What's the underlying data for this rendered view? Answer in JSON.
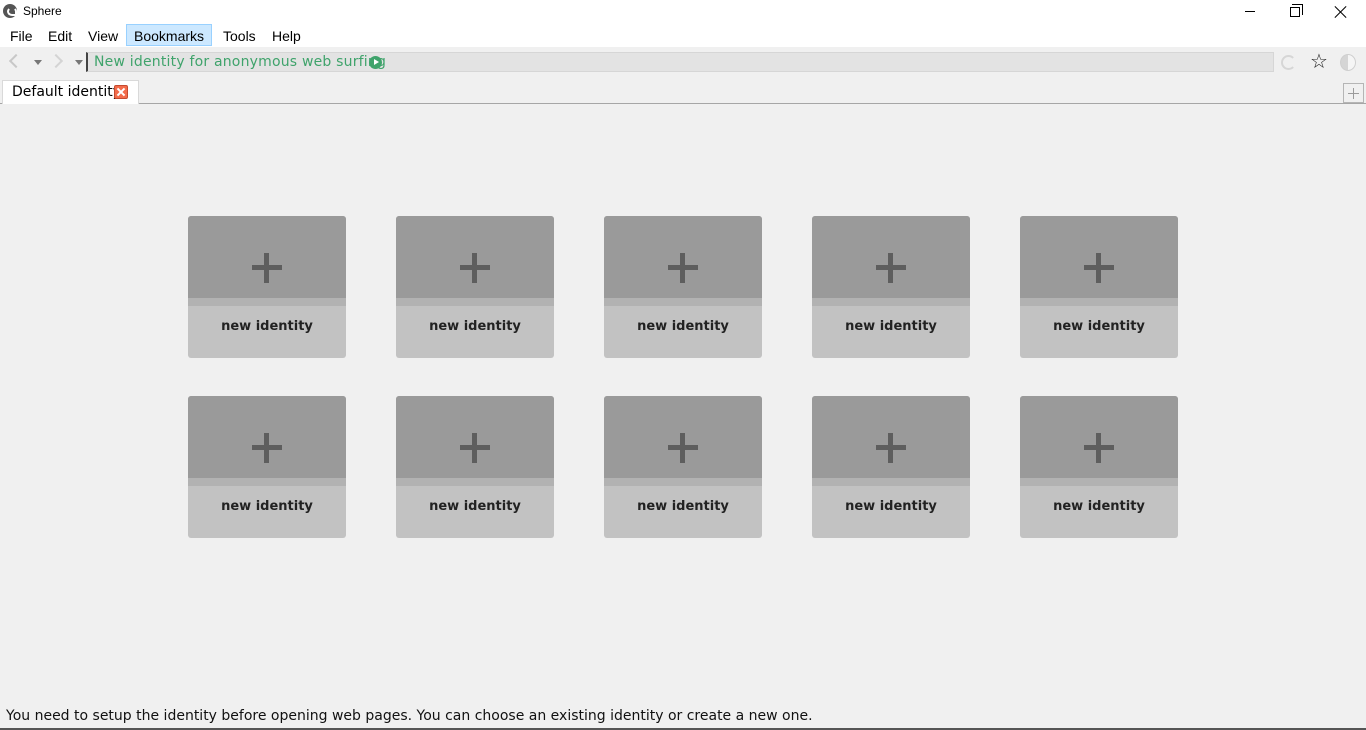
{
  "window": {
    "title": "Sphere"
  },
  "menu": [
    "File",
    "Edit",
    "View",
    "Bookmarks",
    "Tools",
    "Help"
  ],
  "menu_active": "Bookmarks",
  "address_bar": {
    "text": "New identity for anonymous web surfing"
  },
  "tabs": [
    {
      "label": "Default identity"
    }
  ],
  "identities": [
    {
      "label": "new identity"
    },
    {
      "label": "new identity"
    },
    {
      "label": "new identity"
    },
    {
      "label": "new identity"
    },
    {
      "label": "new identity"
    },
    {
      "label": "new identity"
    },
    {
      "label": "new identity"
    },
    {
      "label": "new identity"
    },
    {
      "label": "new identity"
    },
    {
      "label": "new identity"
    }
  ],
  "status": "You need to setup the identity before opening web pages. You can choose an existing identity or create a new one.",
  "colors": {
    "accent_green": "#3fa36b",
    "card_top": "#9a9a9a",
    "card_bottom": "#c2c2c2",
    "tab_close": "#f36b4a"
  },
  "icons": [
    "app-logo-icon",
    "minimize-icon",
    "restore-icon",
    "close-icon",
    "back-arrow-icon",
    "forward-arrow-icon",
    "play-icon",
    "reload-icon",
    "star-icon",
    "shield-icon",
    "tab-close-icon",
    "add-tab-icon",
    "plus-icon"
  ]
}
